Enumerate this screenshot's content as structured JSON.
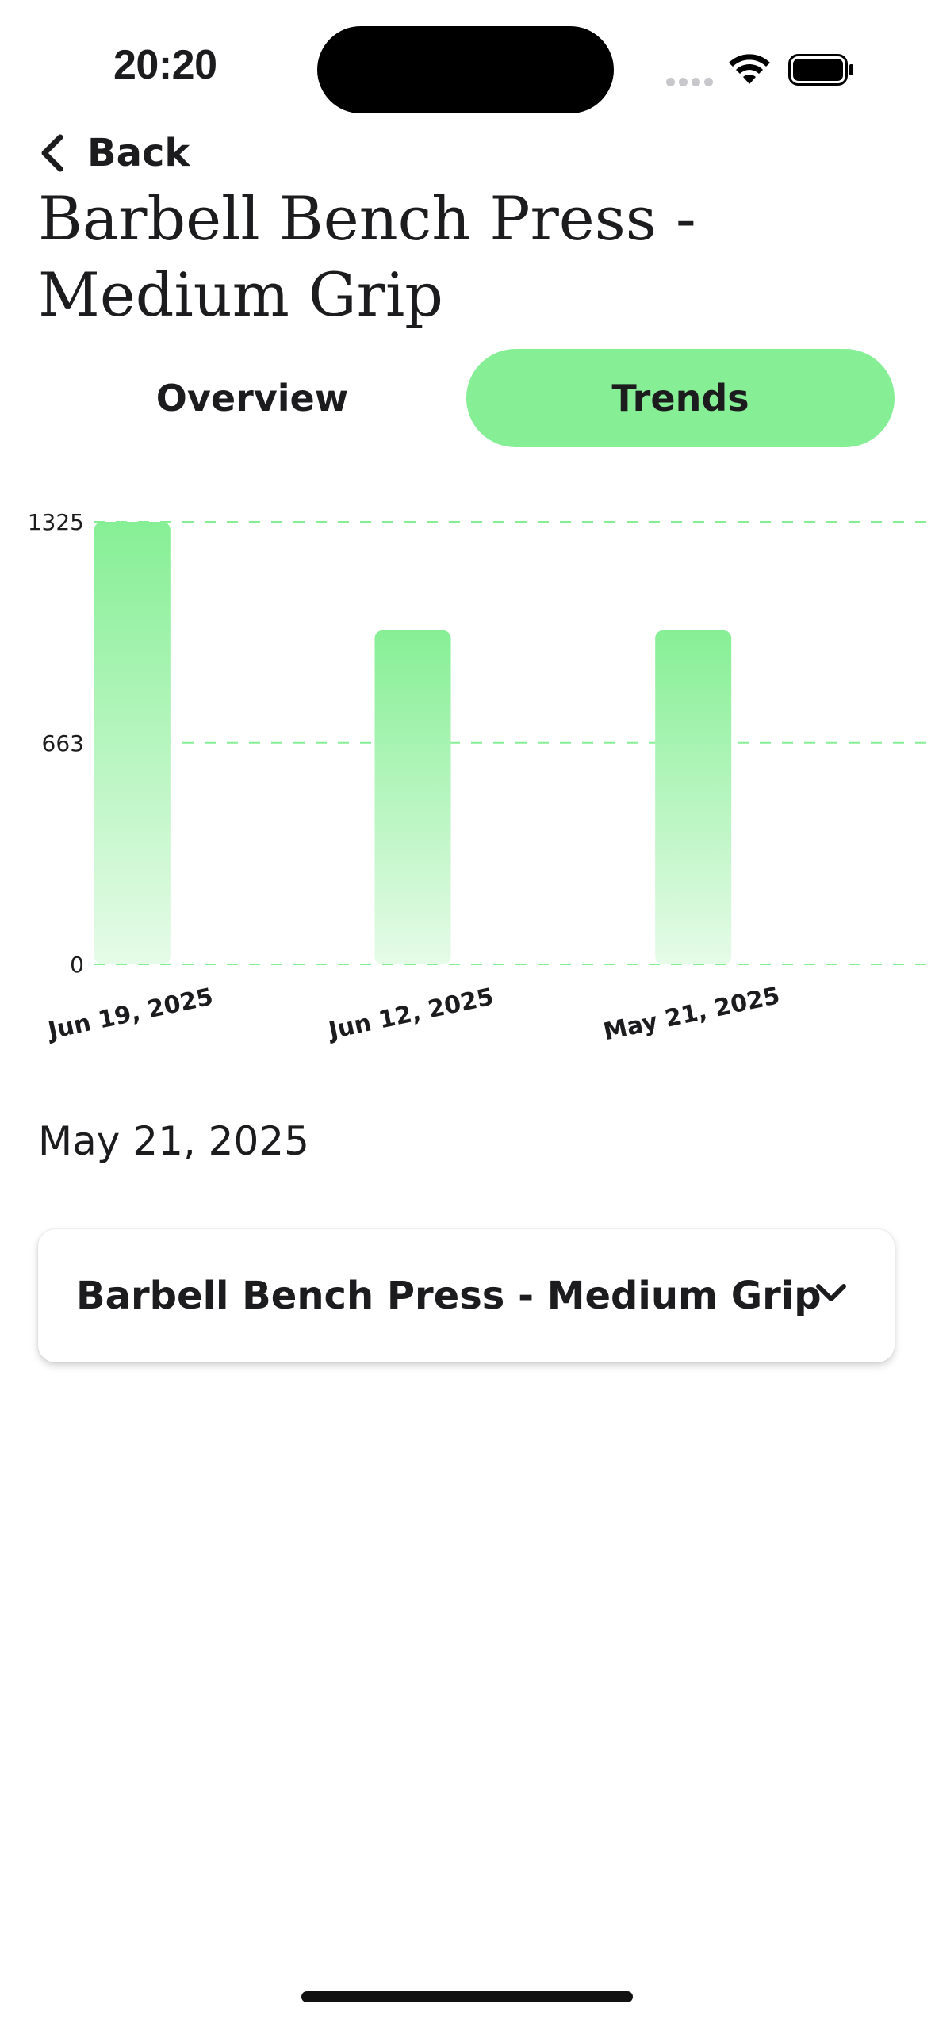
{
  "status_bar": {
    "time": "20:20"
  },
  "nav": {
    "back_label": "Back"
  },
  "page": {
    "title": "Barbell Bench Press - Medium Grip"
  },
  "tabs": [
    {
      "label": "Overview",
      "active": false
    },
    {
      "label": "Trends",
      "active": true
    }
  ],
  "colors": {
    "accent": "#86ef95",
    "gridline": "#86ef95",
    "text": "#1c1c1e"
  },
  "chart_data": {
    "type": "bar",
    "categories": [
      "Jun 19, 2025",
      "Jun 12, 2025",
      "May 21, 2025"
    ],
    "values": [
      1325,
      1000,
      1000
    ],
    "yticks": [
      "0",
      "663",
      "1325"
    ],
    "ylim": [
      0,
      1325
    ],
    "grid": true
  },
  "selected": {
    "date": "May 21, 2025"
  },
  "exercise_card": {
    "name": "Barbell Bench Press - Medium Grip",
    "icon": "chevron-down-icon"
  }
}
